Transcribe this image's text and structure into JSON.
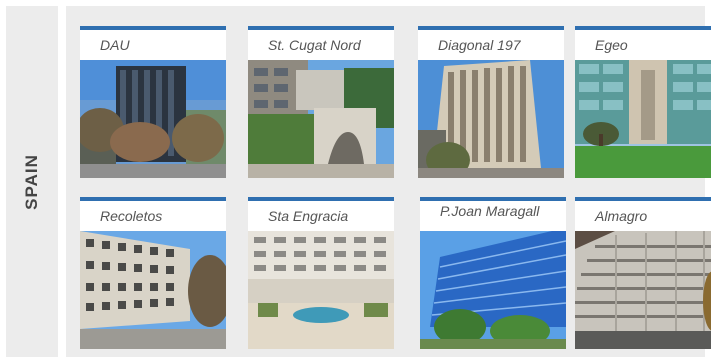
{
  "sidebar": {
    "country": "SPAIN"
  },
  "properties": [
    {
      "name": "DAU"
    },
    {
      "name": "St. Cugat Nord"
    },
    {
      "name": "Diagonal 197"
    },
    {
      "name": "Egeo"
    },
    {
      "name": "Recoletos"
    },
    {
      "name": "Sta Engracia"
    },
    {
      "name": "P.Joan Maragall"
    },
    {
      "name": "Almagro"
    }
  ],
  "colors": {
    "accent_bar": "#2f6fb0",
    "panel_bg": "#ececec",
    "label_text": "#555555"
  }
}
